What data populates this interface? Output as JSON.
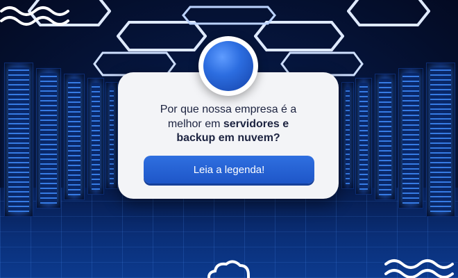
{
  "card": {
    "headline_line1": "Por que nossa empresa é a",
    "headline_line2_a": "melhor em ",
    "headline_line2_b": "servidores e",
    "headline_line3": "backup em nuvem?",
    "cta_label": "Leia a legenda!"
  },
  "icons": {
    "top_left_decoration": "wave-icon",
    "bottom_right_decoration": "wave-icon",
    "bottom_center_decoration": "cloud-icon",
    "card_top": "blue-orb-icon"
  },
  "colors": {
    "accent": "#2F6FE0",
    "card_background": "#F3F4F7",
    "text": "#1C2340",
    "scene_dark": "#030A22"
  }
}
